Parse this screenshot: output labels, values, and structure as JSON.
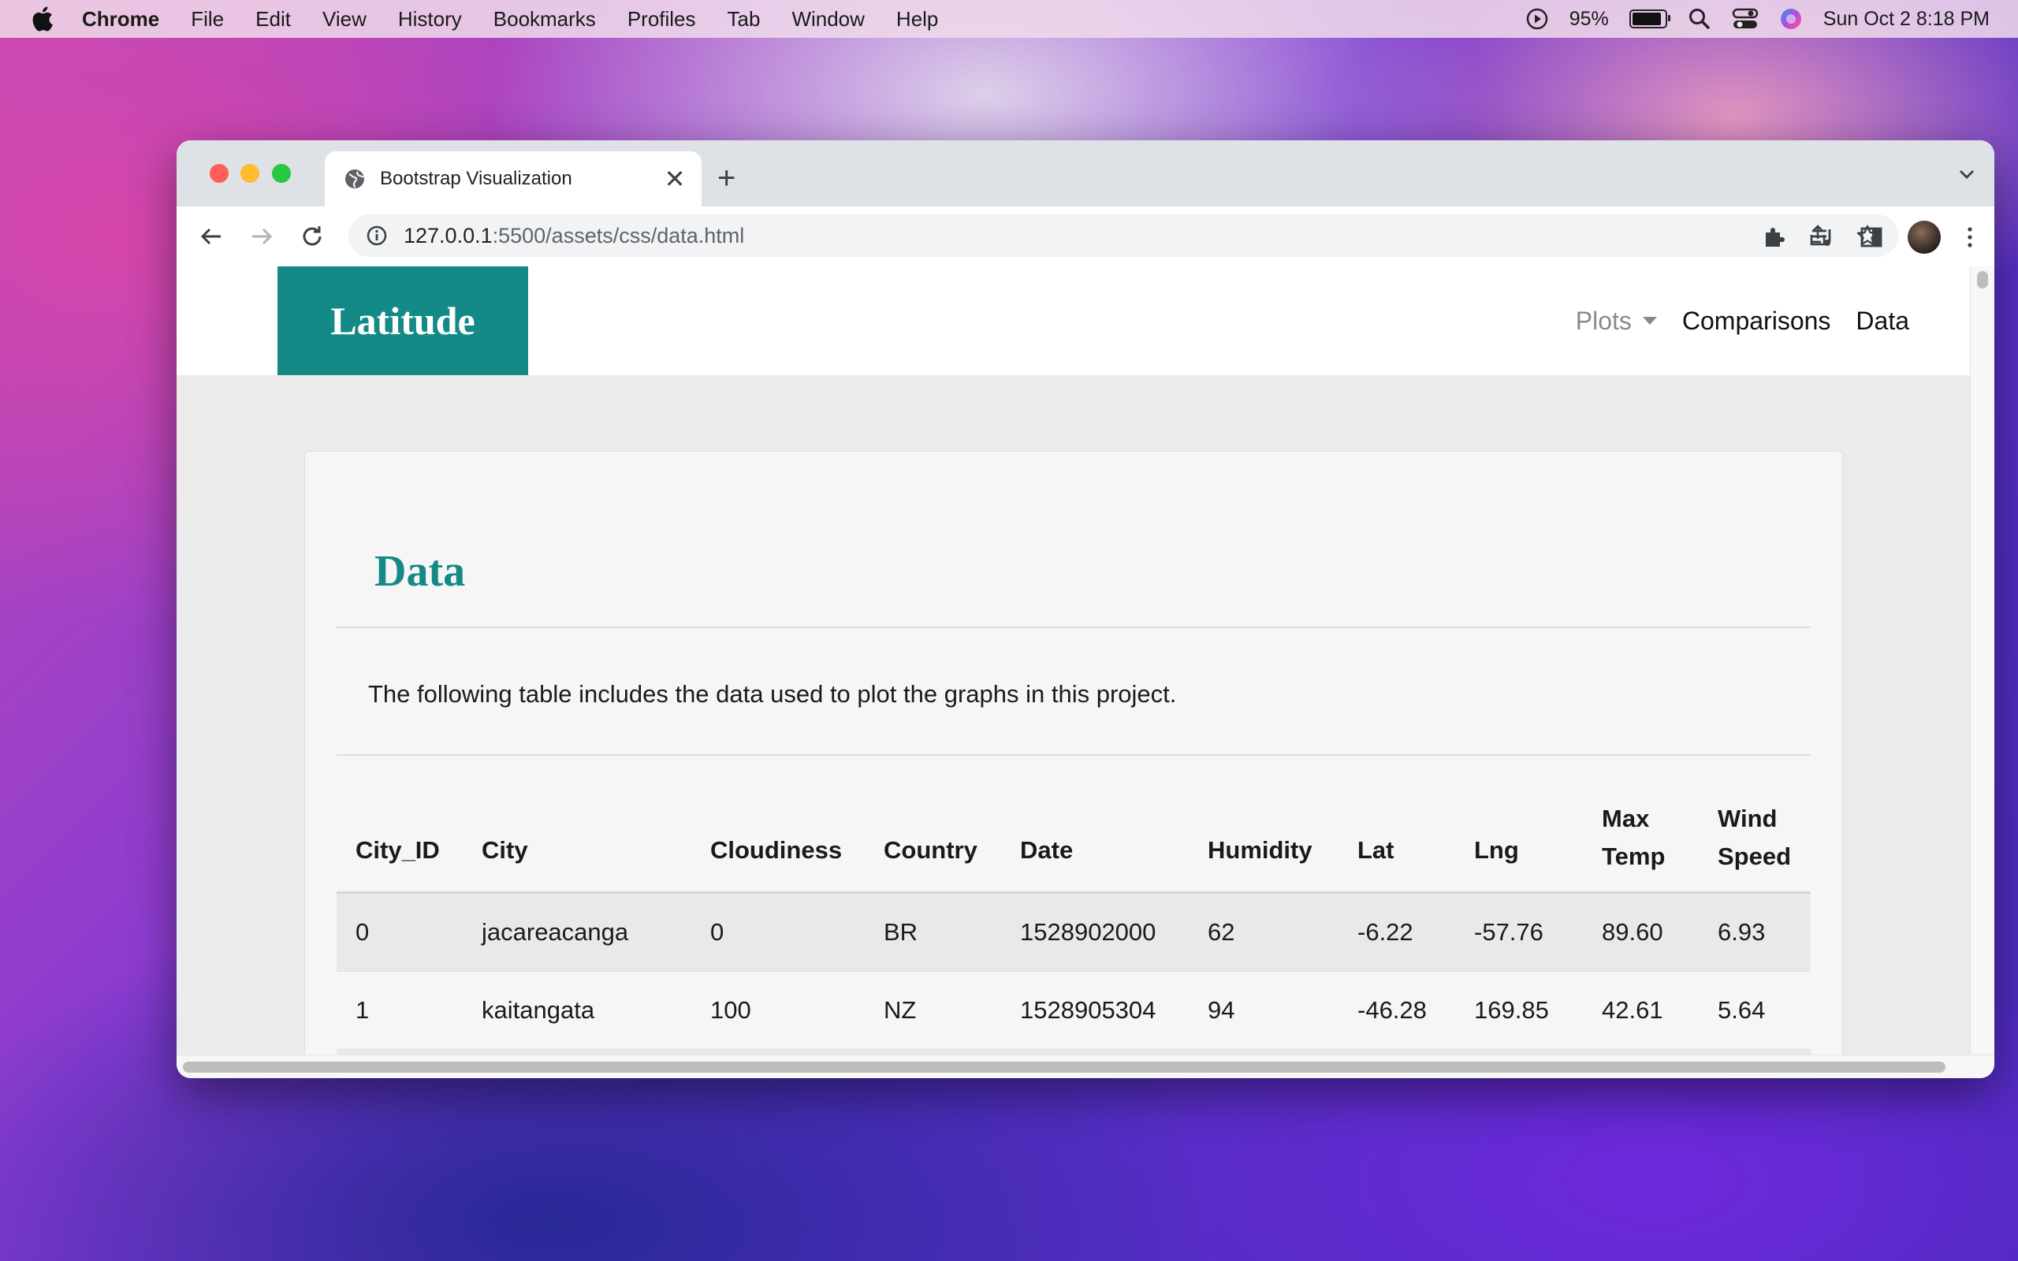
{
  "menubar": {
    "app": "Chrome",
    "items": [
      "File",
      "Edit",
      "View",
      "History",
      "Bookmarks",
      "Profiles",
      "Tab",
      "Window",
      "Help"
    ],
    "battery_percent": "95%",
    "datetime": "Sun Oct 2  8:18 PM"
  },
  "browser": {
    "tab_title": "Bootstrap Visualization",
    "url_host": "127.0.0.1",
    "url_rest": ":5500/assets/css/data.html"
  },
  "site": {
    "brand": "Latitude",
    "nav": {
      "plots": "Plots",
      "comparisons": "Comparisons",
      "data": "Data"
    },
    "title": "Data",
    "intro": "The following table includes the data used to plot the graphs in this project.",
    "table": {
      "headers": [
        "City_ID",
        "City",
        "Cloudiness",
        "Country",
        "Date",
        "Humidity",
        "Lat",
        "Lng",
        "Max Temp",
        "Wind Speed"
      ],
      "rows": [
        [
          "0",
          "jacareacanga",
          "0",
          "BR",
          "1528902000",
          "62",
          "-6.22",
          "-57.76",
          "89.60",
          "6.93"
        ],
        [
          "1",
          "kaitangata",
          "100",
          "NZ",
          "1528905304",
          "94",
          "-46.28",
          "169.85",
          "42.61",
          "5.64"
        ],
        [
          "",
          "",
          "",
          "",
          "",
          "",
          "",
          "",
          "",
          ""
        ]
      ]
    }
  },
  "colors": {
    "brand_teal": "#148a86"
  }
}
